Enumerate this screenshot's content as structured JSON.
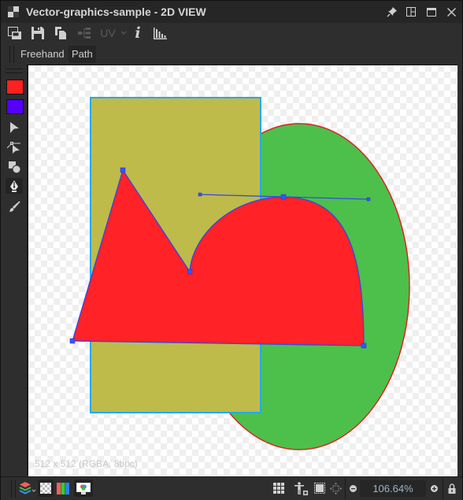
{
  "window": {
    "title": "Vector-graphics-sample - 2D VIEW",
    "icons": [
      "checker-icon",
      "pin-icon",
      "layout-icon",
      "maximize-icon",
      "close-icon"
    ]
  },
  "toolbar": {
    "items": [
      {
        "name": "export-view-icon",
        "enabled": true
      },
      {
        "name": "save-icon",
        "enabled": true
      },
      {
        "name": "copy-icon",
        "enabled": true
      },
      {
        "name": "share-icon",
        "enabled": false
      },
      {
        "name": "uv-dropdown",
        "label": "UV",
        "enabled": false
      },
      {
        "name": "info-icon",
        "label": "i",
        "enabled": true
      },
      {
        "name": "histogram-icon",
        "enabled": true
      }
    ]
  },
  "modes": {
    "tabs": [
      {
        "label": "Freehand",
        "active": false
      },
      {
        "label": "Path",
        "active": true
      }
    ]
  },
  "sidebar": {
    "primary_color": "#ff2020",
    "secondary_color": "#5500ff",
    "tools": [
      {
        "name": "select-tool",
        "active": false
      },
      {
        "name": "direct-select-tool",
        "active": false
      },
      {
        "name": "shapes-tool",
        "active": false
      },
      {
        "name": "pen-tool",
        "active": true
      },
      {
        "name": "brush-tool",
        "active": false
      }
    ]
  },
  "canvas": {
    "info": "512 x 512 (RGBA, 8bpc)",
    "shapes": {
      "rectangle": {
        "fill": "#bebb4a",
        "stroke": "#22aaee"
      },
      "ellipse": {
        "fill": "#4cc04a",
        "stroke": "#dd2222"
      },
      "path": {
        "fill": "#ff2226",
        "stroke": "#3344ee",
        "anchor_color": "#3355ff"
      }
    }
  },
  "statusbar": {
    "zoom": "106.64%",
    "left_icons": [
      "layers-icon",
      "transparency-icon",
      "rgb-channels-icon",
      "display-icon"
    ],
    "right_icons": [
      "grid-icon",
      "pose-icon",
      "fit-icon",
      "center-icon",
      "zoom-out-icon",
      "zoom-in-icon",
      "lock-icon"
    ]
  }
}
